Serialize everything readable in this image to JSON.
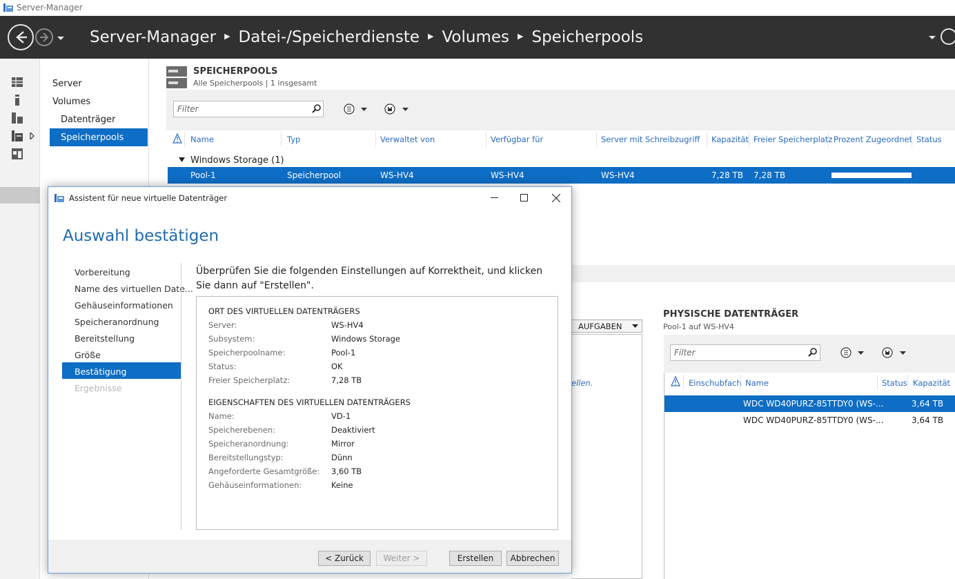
{
  "window": {
    "title": "Server-Manager"
  },
  "breadcrumb": [
    "Server-Manager",
    "Datei-/Speicherdienste",
    "Volumes",
    "Speicherpools"
  ],
  "nav": {
    "items": [
      "Server",
      "Volumes",
      "Datenträger",
      "Speicherpools"
    ],
    "selected": "Speicherpools"
  },
  "pools_section": {
    "title": "SPEICHERPOOLS",
    "subtitle": "Alle Speicherpools | 1 insgesamt",
    "filter_placeholder": "Filter",
    "columns": [
      "Name",
      "Typ",
      "Verwaltet von",
      "Verfügbar für",
      "Server mit Schreibzugriff",
      "Kapazität",
      "Freier Speicherplatz",
      "Prozent Zugeordnet",
      "Status"
    ],
    "group": "Windows Storage (1)",
    "rows": [
      {
        "name": "Pool-1",
        "type": "Speicherpool",
        "managed_by": "WS-HV4",
        "available_to": "WS-HV4",
        "write_server": "WS-HV4",
        "capacity": "7,28 TB",
        "free": "7,28 TB",
        "percent_allocated": 1.0
      }
    ]
  },
  "virtual_disks_section": {
    "tasks_label": "AUFGABEN",
    "partial_text": "ellen."
  },
  "physical_section": {
    "title": "PHYSISCHE DATENTRÄGER",
    "subtitle": "Pool-1 auf WS-HV4",
    "filter_placeholder": "Filter",
    "columns": [
      "Einschubfach",
      "Name",
      "Status",
      "Kapazität"
    ],
    "rows": [
      {
        "name": "WDC WD40PURZ-85TTDY0 (WS-...",
        "capacity": "3,64 TB"
      },
      {
        "name": "WDC WD40PURZ-85TTDY0 (WS-...",
        "capacity": "3,64 TB"
      }
    ]
  },
  "wizard": {
    "title": "Assistent für neue virtuelle Datenträger",
    "heading": "Auswahl bestätigen",
    "steps": [
      "Vorbereitung",
      "Name des virtuellen Date...",
      "Gehäuseinformationen",
      "Speicheranordnung",
      "Bereitstellung",
      "Größe",
      "Bestätigung",
      "Ergebnisse"
    ],
    "current_step": "Bestätigung",
    "intro": "Überprüfen Sie die folgenden Einstellungen auf Korrektheit, und klicken Sie dann auf \"Erstellen\".",
    "location_heading": "ORT DES VIRTUELLEN DATENTRÄGERS",
    "location": [
      {
        "label": "Server:",
        "value": "WS-HV4"
      },
      {
        "label": "Subsystem:",
        "value": "Windows Storage"
      },
      {
        "label": "Speicherpoolname:",
        "value": "Pool-1"
      },
      {
        "label": "Status:",
        "value": "OK"
      },
      {
        "label": "Freier Speicherplatz:",
        "value": "7,28 TB"
      }
    ],
    "properties_heading": "EIGENSCHAFTEN DES VIRTUELLEN DATENTRÄGERS",
    "properties": [
      {
        "label": "Name:",
        "value": "VD-1"
      },
      {
        "label": "Speicherebenen:",
        "value": "Deaktiviert"
      },
      {
        "label": "Speicheranordnung:",
        "value": "Mirror"
      },
      {
        "label": "Bereitstellungstyp:",
        "value": "Dünn"
      },
      {
        "label": "Angeforderte Gesamtgröße:",
        "value": "3,60 TB"
      },
      {
        "label": "Gehäuseinformationen:",
        "value": "Keine"
      }
    ],
    "buttons": {
      "back": "< Zurück",
      "next": "Weiter >",
      "create": "Erstellen",
      "cancel": "Abbrechen"
    }
  },
  "colors": {
    "accent": "#0e6dc4",
    "header_bg": "#313131",
    "link": "#2a6ac1"
  }
}
